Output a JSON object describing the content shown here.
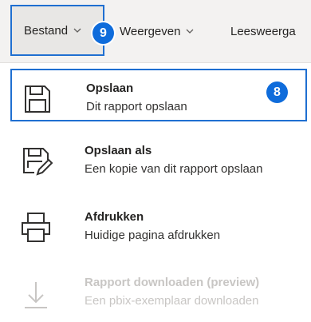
{
  "menubar": {
    "items": [
      {
        "label": "Bestand"
      },
      {
        "label": "Weergeven"
      },
      {
        "label": "Leesweerga"
      }
    ]
  },
  "badges": {
    "file_menu": "9",
    "save_item": "8"
  },
  "dropdown": {
    "items": [
      {
        "title": "Opslaan",
        "desc": "Dit rapport opslaan",
        "icon": "save-icon",
        "selected": true,
        "enabled": true
      },
      {
        "title": "Opslaan als",
        "desc": "Een kopie van dit rapport opslaan",
        "icon": "save-as-icon",
        "selected": false,
        "enabled": true
      },
      {
        "title": "Afdrukken",
        "desc": "Huidige pagina afdrukken",
        "icon": "print-icon",
        "selected": false,
        "enabled": true
      },
      {
        "title": "Rapport downloaden (preview)",
        "desc": "Een pbix-exemplaar downloaden",
        "icon": "download-icon",
        "selected": false,
        "enabled": false
      }
    ]
  },
  "colors": {
    "accent": "#1f6fd1",
    "badge": "#0f6cdb",
    "menubar_bg": "#f3f2f1",
    "disabled_text": "#c8c6c4"
  }
}
